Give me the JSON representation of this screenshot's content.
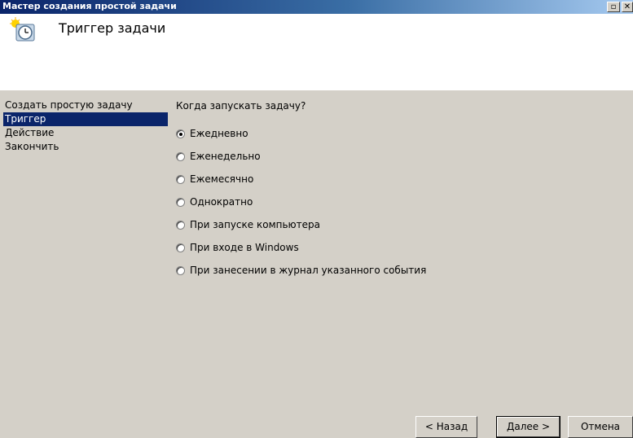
{
  "window": {
    "title": "Мастер создания простой задачи",
    "controls": {
      "restore": "▫",
      "close": "✕"
    }
  },
  "header": {
    "title": "Триггер задачи",
    "icon": "clock-icon"
  },
  "steps": [
    {
      "label": "Создать простую задачу",
      "active": false
    },
    {
      "label": "Триггер",
      "active": true
    },
    {
      "label": "Действие",
      "active": false
    },
    {
      "label": "Закончить",
      "active": false
    }
  ],
  "content": {
    "question": "Когда запускать задачу?",
    "options": [
      {
        "label": "Ежедневно",
        "checked": true
      },
      {
        "label": "Еженедельно",
        "checked": false
      },
      {
        "label": "Ежемесячно",
        "checked": false
      },
      {
        "label": "Однократно",
        "checked": false
      },
      {
        "label": "При запуске компьютера",
        "checked": false
      },
      {
        "label": "При входе в Windows",
        "checked": false
      },
      {
        "label": "При занесении в журнал указанного события",
        "checked": false
      }
    ]
  },
  "buttons": {
    "back": "< Назад",
    "next": "Далее >",
    "cancel": "Отмена"
  },
  "colors": {
    "titlebar_start": "#0a246a",
    "selection": "#0a246a",
    "dialog_bg": "#d4d0c8"
  }
}
